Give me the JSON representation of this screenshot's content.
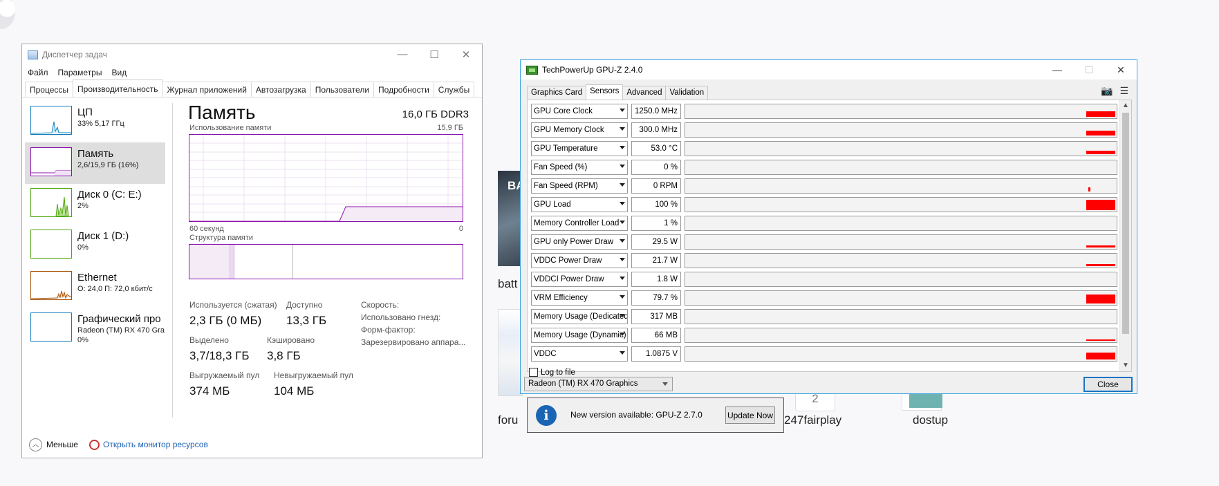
{
  "taskmanager": {
    "title": "Диспетчер задач",
    "menu": [
      "Файл",
      "Параметры",
      "Вид"
    ],
    "tabs": [
      "Процессы",
      "Производительность",
      "Журнал приложений",
      "Автозагрузка",
      "Пользователи",
      "Подробности",
      "Службы"
    ],
    "active_tab": 1,
    "side_items": [
      {
        "name": "ЦП",
        "sub": "33%  5,17 ГГц"
      },
      {
        "name": "Память",
        "sub": "2,6/15,9 ГБ (16%)"
      },
      {
        "name": "Диск 0 (C: E:)",
        "sub": "2%"
      },
      {
        "name": "Диск 1 (D:)",
        "sub": "0%"
      },
      {
        "name": "Ethernet",
        "sub": "О: 24,0  П: 72,0 кбит/с"
      },
      {
        "name": "Графический про",
        "sub": "Radeon (TM) RX 470 Gra",
        "sub2": "0%"
      }
    ],
    "main": {
      "title": "Память",
      "total": "16,0 ГБ DDR3",
      "usage_label": "Использование памяти",
      "usage_max": "15,9 ГБ",
      "time_left": "60 секунд",
      "time_right": "0",
      "structure_label": "Структура памяти",
      "stats": {
        "in_use_label": "Используется (сжатая)",
        "in_use": "2,3 ГБ (0 МБ)",
        "available_label": "Доступно",
        "available": "13,3 ГБ",
        "committed_label": "Выделено",
        "committed": "3,7/18,3 ГБ",
        "cached_label": "Кэшировано",
        "cached": "3,8 ГБ",
        "paged_label": "Выгружаемый пул",
        "paged": "374 МБ",
        "nonpaged_label": "Невыгружаемый пул",
        "nonpaged": "104 МБ",
        "speed_label": "Скорость:",
        "slots_label": "Использовано гнезд:",
        "form_label": "Форм-фактор:",
        "reserved_label": "Зарезервировано аппара..."
      }
    },
    "footer": {
      "less": "Меньше",
      "resmon": "Открыть монитор ресурсов"
    }
  },
  "desktop": {
    "labels": [
      "batt",
      "foru",
      "247fairplay",
      "dostup"
    ],
    "badge": "BA",
    "tile_number": "2"
  },
  "gpuz": {
    "title": "TechPowerUp GPU-Z 2.4.0",
    "tabs": [
      "Graphics Card",
      "Sensors",
      "Advanced",
      "Validation"
    ],
    "active_tab": 1,
    "colors": {
      "bar": "#ff0000",
      "accent": "#1874c6"
    },
    "sensors": [
      {
        "name": "GPU Core Clock",
        "value": "1250.0 MHz",
        "level": 0.45
      },
      {
        "name": "GPU Memory Clock",
        "value": "300.0 MHz",
        "level": 0.4
      },
      {
        "name": "GPU Temperature",
        "value": "53.0 °C",
        "level": 0.28
      },
      {
        "name": "Fan Speed (%)",
        "value": "0 %",
        "level": 0
      },
      {
        "name": "Fan Speed (RPM)",
        "value": "0 RPM",
        "level": 0.35
      },
      {
        "name": "GPU Load",
        "value": "100 %",
        "level": 0.85
      },
      {
        "name": "Memory Controller Load",
        "value": "1 %",
        "level": 0
      },
      {
        "name": "GPU only Power Draw",
        "value": "29.5 W",
        "level": 0.15
      },
      {
        "name": "VDDC Power Draw",
        "value": "21.7 W",
        "level": 0.15
      },
      {
        "name": "VDDCI Power Draw",
        "value": "1.8 W",
        "level": 0
      },
      {
        "name": "VRM Efficiency",
        "value": "79.7 %",
        "level": 0.7
      },
      {
        "name": "Memory Usage (Dedicated)",
        "value": "317 MB",
        "level": 0
      },
      {
        "name": "Memory Usage (Dynamic)",
        "value": "66 MB",
        "level": 0.05
      },
      {
        "name": "VDDC",
        "value": "1.0875 V",
        "level": 0.55
      }
    ],
    "log_to_file": "Log to file",
    "device": "Radeon (TM) RX 470 Graphics",
    "close": "Close",
    "notification": {
      "text": "New version available: GPU-Z 2.7.0",
      "button": "Update Now"
    }
  }
}
